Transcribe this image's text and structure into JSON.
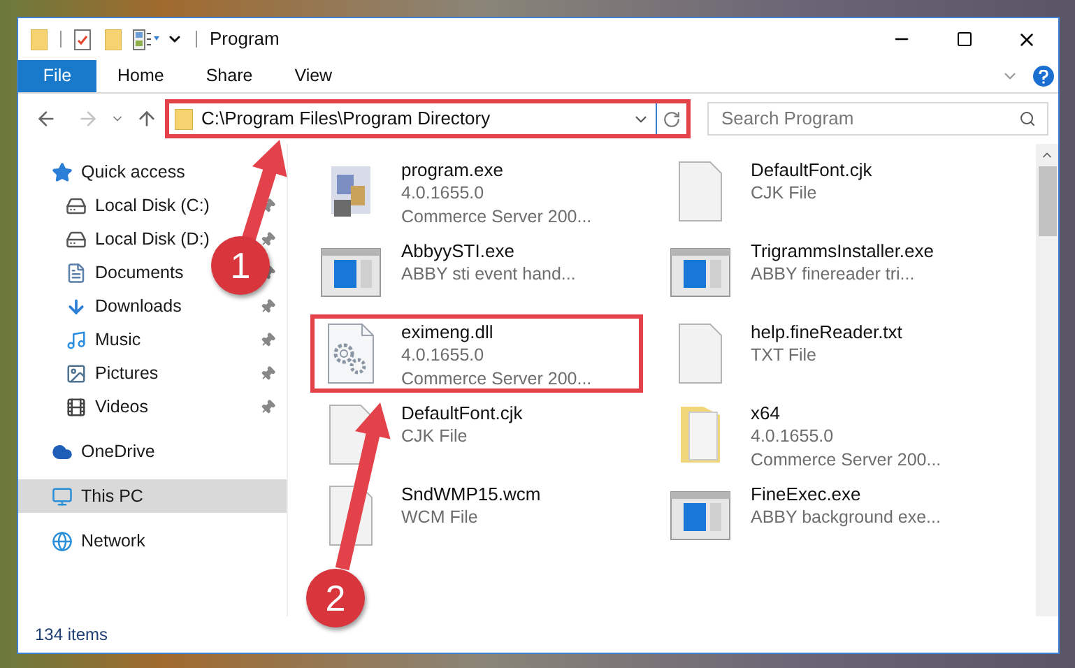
{
  "window": {
    "title": "Program"
  },
  "ribbon_tabs": [
    {
      "label": "File",
      "selected": true
    },
    {
      "label": "Home",
      "selected": false
    },
    {
      "label": "Share",
      "selected": false
    },
    {
      "label": "View",
      "selected": false
    }
  ],
  "address": {
    "path": "C:\\Program Files\\Program Directory",
    "highlighted": true
  },
  "search": {
    "placeholder": "Search Program"
  },
  "nav": [
    {
      "label": "Quick access",
      "kind": "star",
      "selected": false,
      "children": [
        {
          "label": "Local Disk (C:)",
          "kind": "drive-win",
          "pinned": true,
          "selected": false
        },
        {
          "label": "Local Disk (D:)",
          "kind": "drive",
          "pinned": true,
          "selected": false
        },
        {
          "label": "Documents",
          "kind": "doc",
          "pinned": true,
          "selected": false
        },
        {
          "label": "Downloads",
          "kind": "download",
          "pinned": true,
          "selected": false
        },
        {
          "label": "Music",
          "kind": "music",
          "pinned": true,
          "selected": false
        },
        {
          "label": "Pictures",
          "kind": "picture",
          "pinned": true,
          "selected": false
        },
        {
          "label": "Videos",
          "kind": "video",
          "pinned": true,
          "selected": false
        }
      ]
    },
    {
      "label": "OneDrive",
      "kind": "cloud",
      "selected": false
    },
    {
      "label": "This PC",
      "kind": "pc",
      "selected": true
    },
    {
      "label": "Network",
      "kind": "network",
      "selected": false
    }
  ],
  "files": [
    {
      "name": "program.exe",
      "details": [
        "4.0.1655.0",
        "Commerce Server 200..."
      ],
      "kind": "app",
      "highlighted": false
    },
    {
      "name": "DefaultFont.cjk",
      "details": [
        "CJK File"
      ],
      "kind": "blank",
      "highlighted": false
    },
    {
      "name": "AbbyySTI.exe",
      "details": [
        "ABBY sti event hand..."
      ],
      "kind": "window",
      "highlighted": false
    },
    {
      "name": "TrigrammsInstaller.exe",
      "details": [
        "ABBY finereader tri..."
      ],
      "kind": "window",
      "highlighted": false
    },
    {
      "name": "eximeng.dll",
      "details": [
        "4.0.1655.0",
        "Commerce Server 200..."
      ],
      "kind": "gear",
      "highlighted": true
    },
    {
      "name": "help.fineReader.txt",
      "details": [
        "TXT File"
      ],
      "kind": "blank",
      "highlighted": false
    },
    {
      "name": "DefaultFont.cjk",
      "details": [
        "CJK File"
      ],
      "kind": "blank",
      "highlighted": false
    },
    {
      "name": "x64",
      "details": [
        "4.0.1655.0",
        "Commerce Server 200..."
      ],
      "kind": "folder",
      "highlighted": false
    },
    {
      "name": "SndWMP15.wcm",
      "details": [
        "WCM File"
      ],
      "kind": "blank",
      "highlighted": false
    },
    {
      "name": "FineExec.exe",
      "details": [
        "ABBY background exe..."
      ],
      "kind": "window",
      "highlighted": false
    }
  ],
  "status_bar": {
    "item_count": "134 items"
  },
  "annotations": [
    {
      "label": "1"
    },
    {
      "label": "2"
    }
  ]
}
